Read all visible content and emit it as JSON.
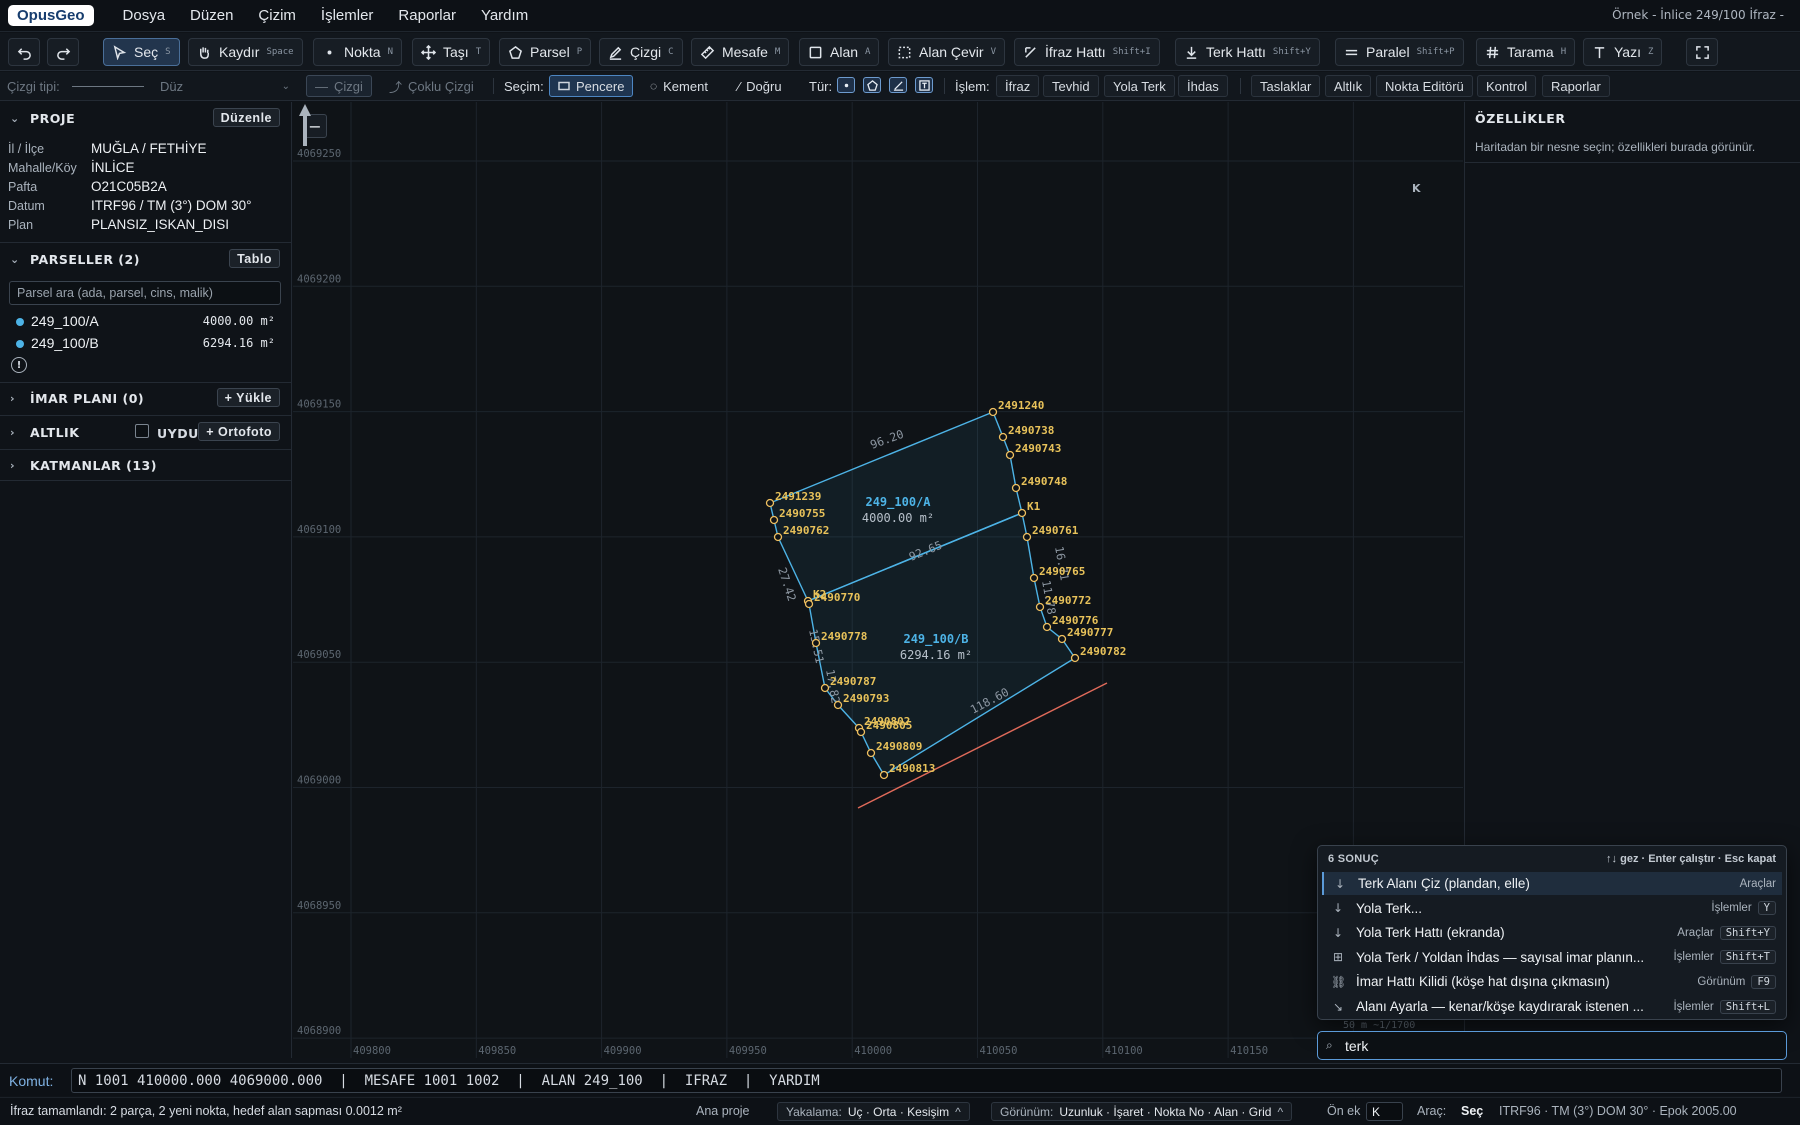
{
  "app": {
    "logo": "OpusGeo",
    "document_title": "Örnek - İnlice 249/100 İfraz -"
  },
  "menu": [
    "Dosya",
    "Düzen",
    "Çizim",
    "İşlemler",
    "Raporlar",
    "Yardım"
  ],
  "toolbar": {
    "undo_icon": "undo-icon",
    "redo_icon": "redo-icon",
    "tools": [
      {
        "label": "Seç",
        "key": "S",
        "icon": "cursor-icon",
        "active": true
      },
      {
        "label": "Kaydır",
        "key": "Space",
        "icon": "hand-icon"
      },
      {
        "label": "Nokta",
        "key": "N",
        "icon": "dot-icon"
      },
      {
        "label": "Taşı",
        "key": "T",
        "icon": "move-icon"
      },
      {
        "label": "Parsel",
        "key": "P",
        "icon": "pentagon-icon"
      },
      {
        "label": "Çizgi",
        "key": "C",
        "icon": "pen-icon"
      },
      {
        "label": "Mesafe",
        "key": "M",
        "icon": "ruler-icon"
      },
      {
        "label": "Alan",
        "key": "A",
        "icon": "square-icon"
      },
      {
        "label": "Alan Çevir",
        "key": "V",
        "icon": "dashed-square-icon"
      },
      {
        "label": "İfraz Hattı",
        "key": "Shift+I",
        "icon": "split-icon"
      },
      {
        "label": "Terk Hattı",
        "key": "Shift+Y",
        "icon": "arrow-down-line-icon"
      },
      {
        "label": "Paralel",
        "key": "Shift+P",
        "icon": "parallel-icon"
      },
      {
        "label": "Tarama",
        "key": "H",
        "icon": "hash-icon"
      },
      {
        "label": "Yazı",
        "key": "Z",
        "icon": "text-icon"
      }
    ],
    "fullscreen_icon": "fullscreen-icon"
  },
  "toolbar2": {
    "line_type_label": "Çizgi tipi:",
    "line_style_value": "Düz",
    "cizgi": "Çizgi",
    "coklu_cizgi": "Çoklu Çizgi",
    "secim_label": "Seçim:",
    "pencere": "Pencere",
    "kement": "Kement",
    "dogru": "Doğru",
    "tur_label": "Tür:",
    "islem_label": "İşlem:",
    "islem_buttons": [
      "İfraz",
      "Tevhid",
      "Yola Terk",
      "İhdas"
    ],
    "extra_buttons": [
      "Taslaklar",
      "Altlık",
      "Nokta Editörü",
      "Kontrol",
      "Raporlar"
    ]
  },
  "left_panel": {
    "proje": {
      "title": "PROJE",
      "edit_button": "Düzenle",
      "rows": [
        {
          "key": "İl / İlçe",
          "value": "MUĞLA / FETHİYE"
        },
        {
          "key": "Mahalle/Köy",
          "value": "İNLİCE"
        },
        {
          "key": "Pafta",
          "value": "O21C05B2A"
        },
        {
          "key": "Datum",
          "value": "ITRF96 / TM (3°) DOM 30°"
        },
        {
          "key": "Plan",
          "value": "PLANSIZ_ISKAN_DISI"
        }
      ]
    },
    "parseller": {
      "title": "PARSELLER (2)",
      "table_button": "Tablo",
      "search_placeholder": "Parsel ara (ada, parsel, cins, malik)",
      "items": [
        {
          "name": "249_100/A",
          "area": "4000.00 m²"
        },
        {
          "name": "249_100/B",
          "area": "6294.16 m²"
        }
      ]
    },
    "imar": {
      "title": "İMAR PLANI (0)",
      "button": "+ Yükle"
    },
    "altlik": {
      "title": "ALTLIK",
      "uydu": "UYDU",
      "button": "+ Ortofoto"
    },
    "katmanlar": {
      "title": "KATMANLAR (13)"
    }
  },
  "map": {
    "y_ticks": [
      "4069250",
      "4069200",
      "4069150",
      "4069100",
      "4069050",
      "4069000",
      "4068950",
      "4068900"
    ],
    "x_ticks": [
      "409800",
      "409850",
      "409900",
      "409950",
      "410000",
      "410050",
      "410100",
      "410150"
    ],
    "north_label": "K",
    "scale_text": "50 m  ~1/1700",
    "parcels": [
      {
        "name": "249_100/A",
        "area": "4000.00 m²"
      },
      {
        "name": "249_100/B",
        "area": "6294.16 m²"
      }
    ],
    "edge_labels": [
      "96.20",
      "92.65",
      "118.60",
      "27.42",
      "15.51",
      "17.82",
      "16.71",
      "11.78"
    ],
    "point_labels": [
      "2491240",
      "2490738",
      "2490743",
      "2490748",
      "K1",
      "2490761",
      "2490765",
      "2490772",
      "2490776",
      "2490777",
      "2490782",
      "2491239",
      "2490755",
      "2490762",
      "K2",
      "2490770",
      "2490778",
      "2490787",
      "2490793",
      "2490802",
      "2490805",
      "2490809",
      "2490813"
    ],
    "colors": {
      "parcel": "#4db3e6",
      "point": "#f0c060",
      "road": "#e06a5a",
      "label": "#e8c25a"
    }
  },
  "right_panel": {
    "title": "ÖZELLİKLER",
    "hint": "Haritadan bir nesne seçin; özellikleri burada görünür."
  },
  "palette": {
    "count": "6 SONUÇ",
    "hint": "↑↓ gez · Enter çalıştır · Esc kapat",
    "results": [
      {
        "icon": "↓",
        "label": "Terk Alanı Çiz (plandan, elle)",
        "category": "Araçlar",
        "key": ""
      },
      {
        "icon": "↓",
        "label": "Yola Terk...",
        "category": "İşlemler",
        "key": "Y"
      },
      {
        "icon": "↓",
        "label": "Yola Terk Hattı (ekranda)",
        "category": "Araçlar",
        "key": "Shift+Y"
      },
      {
        "icon": "⊞",
        "label": "Yola Terk / Yoldan İhdas — sayısal imar planın...",
        "category": "İşlemler",
        "key": "Shift+T"
      },
      {
        "icon": "⛓",
        "label": "İmar Hattı Kilidi (köşe hat dışına çıkmasın)",
        "category": "Görünüm",
        "key": "F9"
      },
      {
        "icon": "↘",
        "label": "Alanı Ayarla — kenar/köşe kaydırarak istenen ...",
        "category": "İşlemler",
        "key": "Shift+L"
      }
    ],
    "query": "terk"
  },
  "command": {
    "label": "Komut:",
    "value": "N 1001 410000.000 4069000.000  |  MESAFE 1001 1002  |  ALAN 249_100  |  IFRAZ  |  YARDIM"
  },
  "status": {
    "message": "İfraz tamamlandı: 2 parça, 2 yeni nokta, hedef alan sapması 0.0012 m²",
    "ana_proje": "Ana proje",
    "yakalama_label": "Yakalama:",
    "yakalama_value": "Uç · Orta · Kesişim",
    "gorunum_label": "Görünüm:",
    "gorunum_value": "Uzunluk · İşaret · Nokta No · Alan · Grid",
    "onek_label": "Ön ek",
    "onek_value": "K",
    "arac_label": "Araç:",
    "arac_value": "Seç",
    "crs": "ITRF96 · TM (3°) DOM 30° · Epok 2005.00"
  }
}
